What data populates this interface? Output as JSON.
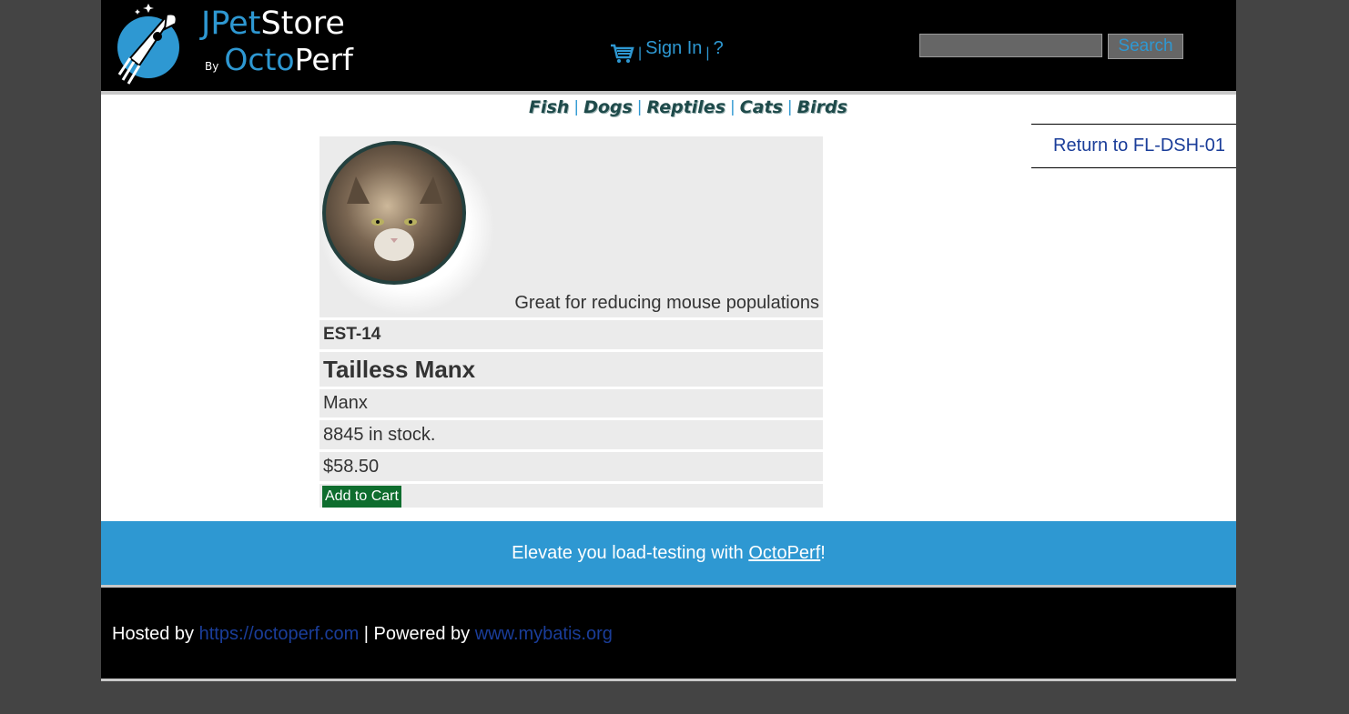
{
  "header": {
    "logo": {
      "jpet": "JPet",
      "store": "Store",
      "by": "By",
      "octo": "Octo",
      "perf": "Perf"
    },
    "menu": {
      "cart_icon": "shopping-cart-icon",
      "sep": "|",
      "sign_in": "Sign In",
      "help": "?"
    },
    "search": {
      "value": "",
      "button": "Search"
    }
  },
  "quicklinks": [
    "Fish",
    "Dogs",
    "Reptiles",
    "Cats",
    "Birds"
  ],
  "back_link": "Return to FL-DSH-01",
  "item": {
    "description": "Great for reducing mouse populations",
    "id": "EST-14",
    "name": "Tailless Manx",
    "type": "Manx",
    "stock": "8845 in stock.",
    "price": "$58.50",
    "add_to_cart": "Add to Cart"
  },
  "promo": {
    "text_before": "Elevate you load-testing with ",
    "link": "OctoPerf",
    "text_after": "!"
  },
  "footer": {
    "hosted_by": "Hosted by ",
    "hosted_link": "https://octoperf.com",
    "powered_by": " | Powered by ",
    "powered_link": "www.mybatis.org"
  },
  "colors": {
    "accent": "#2e98d2",
    "link_dark": "#1a3d99",
    "cart_button": "#0e6d2e"
  }
}
